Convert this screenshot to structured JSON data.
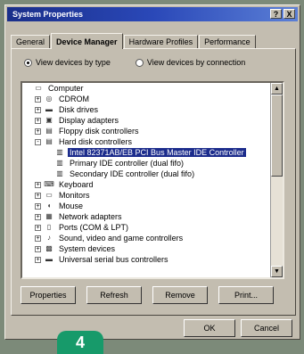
{
  "window": {
    "title": "System Properties",
    "help_label": "?",
    "close_label": "X"
  },
  "tabs": [
    "General",
    "Device Manager",
    "Hardware Profiles",
    "Performance"
  ],
  "active_tab_index": 1,
  "view_options": [
    {
      "label": "View devices by type",
      "selected": true
    },
    {
      "label": "View devices by connection",
      "selected": false
    }
  ],
  "tree": [
    {
      "label": "Computer",
      "level": 0,
      "expander": "",
      "icon": "computer-icon",
      "glyph": "▭"
    },
    {
      "label": "CDROM",
      "level": 1,
      "expander": "+",
      "icon": "cdrom-icon",
      "glyph": "◎"
    },
    {
      "label": "Disk drives",
      "level": 1,
      "expander": "+",
      "icon": "disk-drive-icon",
      "glyph": "▬"
    },
    {
      "label": "Display adapters",
      "level": 1,
      "expander": "+",
      "icon": "display-adapter-icon",
      "glyph": "▣"
    },
    {
      "label": "Floppy disk controllers",
      "level": 1,
      "expander": "+",
      "icon": "floppy-controller-icon",
      "glyph": "▤"
    },
    {
      "label": "Hard disk controllers",
      "level": 1,
      "expander": "-",
      "icon": "hard-disk-controller-icon",
      "glyph": "▤"
    },
    {
      "label": "Intel 82371AB/EB PCI Bus Master IDE Controller",
      "level": 2,
      "expander": "",
      "icon": "ide-controller-icon",
      "glyph": "▥",
      "selected": true
    },
    {
      "label": "Primary IDE controller (dual fifo)",
      "level": 2,
      "expander": "",
      "icon": "ide-controller-icon",
      "glyph": "▥"
    },
    {
      "label": "Secondary IDE controller (dual fifo)",
      "level": 2,
      "expander": "",
      "icon": "ide-controller-icon",
      "glyph": "▥"
    },
    {
      "label": "Keyboard",
      "level": 1,
      "expander": "+",
      "icon": "keyboard-icon",
      "glyph": "⌨"
    },
    {
      "label": "Monitors",
      "level": 1,
      "expander": "+",
      "icon": "monitor-icon",
      "glyph": "▭"
    },
    {
      "label": "Mouse",
      "level": 1,
      "expander": "+",
      "icon": "mouse-icon",
      "glyph": "◖"
    },
    {
      "label": "Network adapters",
      "level": 1,
      "expander": "+",
      "icon": "network-adapter-icon",
      "glyph": "▦"
    },
    {
      "label": "Ports (COM & LPT)",
      "level": 1,
      "expander": "+",
      "icon": "port-icon",
      "glyph": "▯"
    },
    {
      "label": "Sound, video and game controllers",
      "level": 1,
      "expander": "+",
      "icon": "sound-icon",
      "glyph": "♪"
    },
    {
      "label": "System devices",
      "level": 1,
      "expander": "+",
      "icon": "system-devices-icon",
      "glyph": "▩"
    },
    {
      "label": "Universal serial bus controllers",
      "level": 1,
      "expander": "+",
      "icon": "usb-icon",
      "glyph": "▬"
    }
  ],
  "actions": {
    "properties": "Properties",
    "refresh": "Refresh",
    "remove": "Remove",
    "print": "Print..."
  },
  "dialog_buttons": {
    "ok": "OK",
    "cancel": "Cancel"
  },
  "badge": {
    "number": "4"
  },
  "colors": {
    "titlebar": "#1a2f8a",
    "selection": "#1c2c8c",
    "face": "#c3bdb0",
    "badge": "#179a6a"
  }
}
